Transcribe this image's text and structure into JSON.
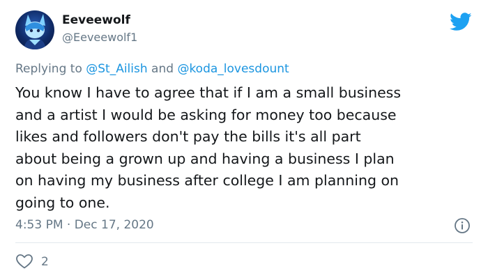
{
  "author": {
    "display_name": "Eeveewolf",
    "handle": "@Eeveewolf1"
  },
  "reply": {
    "prefix": "Replying to ",
    "mention_1": "@St_Ailish",
    "conjunction": " and ",
    "mention_2": "@koda_lovesdount"
  },
  "tweet": {
    "lines": [
      "You know I have to agree that if I am a small business",
      "and a artist I would be asking for money too because",
      "likes and followers don't pay the bills it's all part",
      "about being a grown up and having a business I plan",
      "on having my business after college I am planning on",
      "going to one."
    ],
    "timestamp": "4:53 PM · Dec 17, 2020"
  },
  "stats": {
    "likes": "2"
  },
  "icons": {
    "brand": "twitter-bird-icon",
    "info": "info-icon",
    "like": "heart-icon"
  },
  "colors": {
    "brand_blue": "#1da1f2",
    "link_blue": "#1b95e0",
    "secondary_text": "#657786",
    "divider": "#e1e8ed"
  }
}
